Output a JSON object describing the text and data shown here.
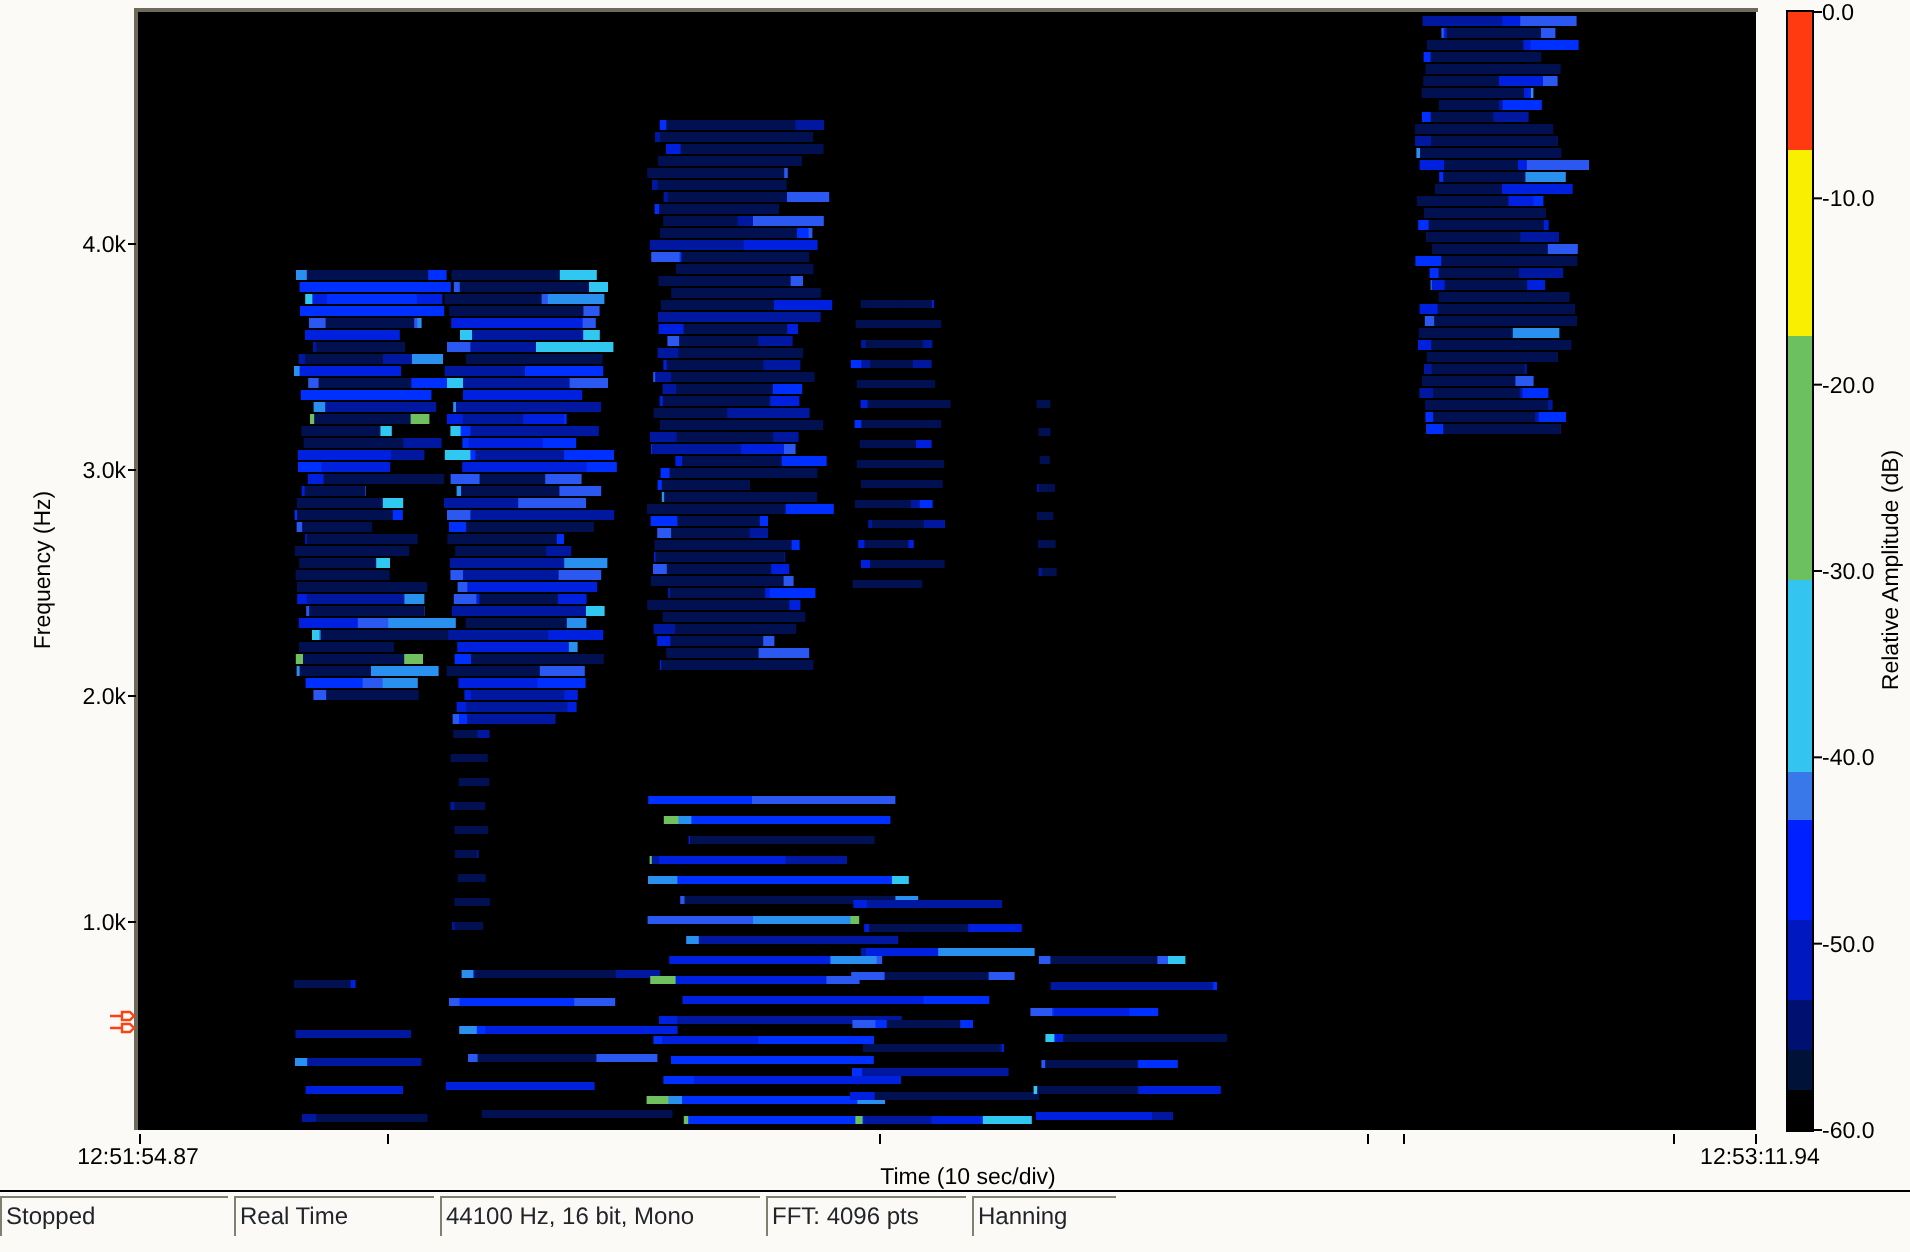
{
  "spectrogram": {
    "ylabel": "Frequency (Hz)",
    "yticks": [
      "4.0k",
      "3.0k",
      "2.0k",
      "1.0k"
    ],
    "xlabel": "Time (10 sec/div)",
    "start_time": "12:51:54.87",
    "end_time": "12:53:11.94"
  },
  "colorbar": {
    "label": "Relative Amplitude (dB)",
    "ticks": [
      "0.0",
      "-10.0",
      "-20.0",
      "-30.0",
      "-40.0",
      "-50.0",
      "-60.0"
    ]
  },
  "status_bar": [
    "Stopped",
    "Real Time",
    "44100 Hz, 16 bit, Mono",
    "FFT: 4096 pts",
    "Hanning"
  ]
}
